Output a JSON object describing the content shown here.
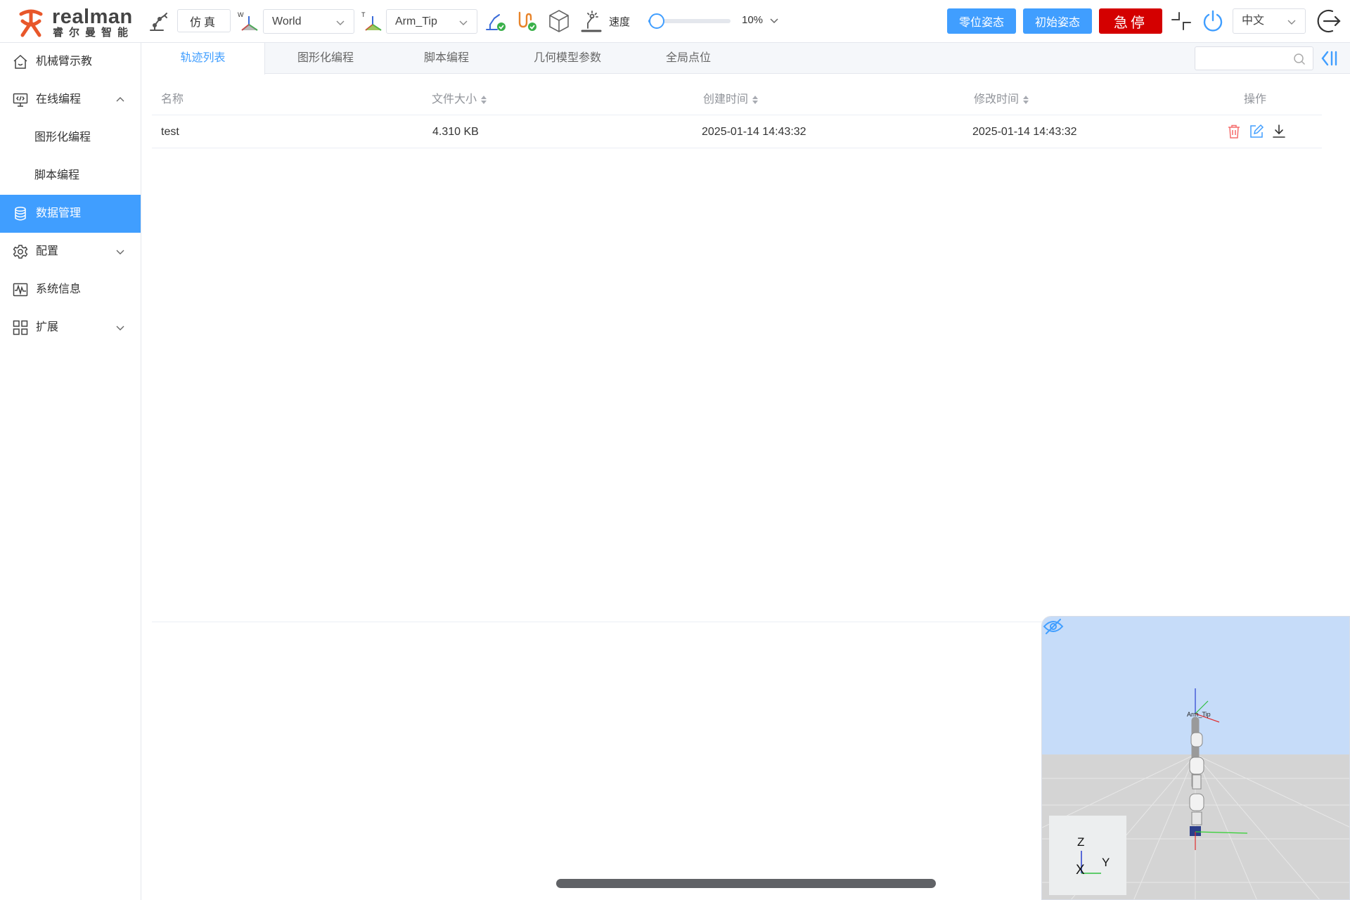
{
  "header": {
    "logo_text": "realman",
    "logo_subtext": "睿尔曼智能",
    "sim_button": "仿真",
    "frame_select": "World",
    "frame_tag": "W",
    "tool_select": "Arm_Tip",
    "tool_tag": "T",
    "speed_label": "速度",
    "speed_value": "10%",
    "speed_fraction": 0.1,
    "zero_pose_button": "零位姿态",
    "init_pose_button": "初始姿态",
    "estop_button": "急停",
    "language_select": "中文",
    "accent_color": "#409eff",
    "estop_color": "#d40000"
  },
  "sidebar": {
    "items": [
      {
        "label": "机械臂示教",
        "icon": "home-icon"
      },
      {
        "label": "在线编程",
        "icon": "monitor-code-icon"
      },
      {
        "label": "图形化编程"
      },
      {
        "label": "脚本编程"
      },
      {
        "label": "数据管理",
        "icon": "database-icon"
      },
      {
        "label": "配置",
        "icon": "gear-icon"
      },
      {
        "label": "系统信息",
        "icon": "waveform-icon"
      },
      {
        "label": "扩展",
        "icon": "apps-icon"
      }
    ]
  },
  "tabs": [
    {
      "label": "轨迹列表"
    },
    {
      "label": "图形化编程"
    },
    {
      "label": "脚本编程"
    },
    {
      "label": "几何模型参数"
    },
    {
      "label": "全局点位"
    }
  ],
  "search": {
    "value": ""
  },
  "table": {
    "columns": [
      "名称",
      "文件大小",
      "创建时间",
      "修改时间",
      "操作"
    ],
    "rows": [
      {
        "name": "test",
        "size": "4.310 KB",
        "created": "2025-01-14 14:43:32",
        "modified": "2025-01-14 14:43:32"
      }
    ]
  },
  "viewer": {
    "tip_label": "Arm_Tip",
    "axis_z": "Z",
    "axis_x": "X",
    "axis_y": "Y",
    "sky_color": "#c6dcf9",
    "floor_color": "#d4d4d4"
  }
}
